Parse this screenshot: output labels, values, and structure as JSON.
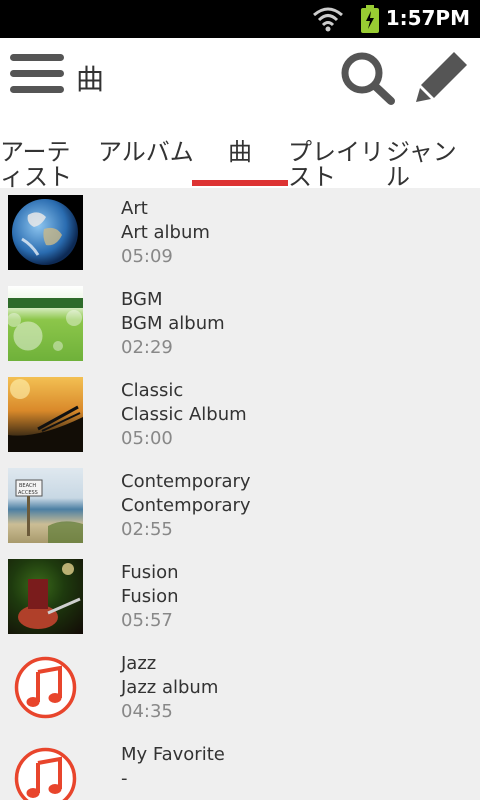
{
  "status_bar": {
    "time": "1:57PM",
    "icons": [
      "wifi-icon",
      "battery-charging-icon"
    ]
  },
  "action_bar": {
    "title": "曲",
    "icons": [
      "menu-icon",
      "search-icon",
      "edit-icon"
    ]
  },
  "tabs": [
    {
      "label": "アーティスト",
      "selected": false
    },
    {
      "label": "アルバム",
      "selected": false
    },
    {
      "label": "曲",
      "selected": true
    },
    {
      "label": "プレイリスト",
      "selected": false
    },
    {
      "label": "ジャンル",
      "selected": false
    }
  ],
  "colors": {
    "accent": "#d33333",
    "note_icon": "#e8452c"
  },
  "songs": [
    {
      "title": "Art",
      "album": "Art album",
      "duration": "05:09",
      "thumb": "earth-photo"
    },
    {
      "title": "BGM",
      "album": "BGM album",
      "duration": "02:29",
      "thumb": "bubbles-field-photo"
    },
    {
      "title": "Classic",
      "album": "Classic Album",
      "duration": "05:00",
      "thumb": "boat-sunset-photo"
    },
    {
      "title": "Contemporary",
      "album": "Contemporary",
      "duration": "02:55",
      "thumb": "beach-access-photo"
    },
    {
      "title": "Fusion",
      "album": "Fusion",
      "duration": "05:57",
      "thumb": "guitarist-photo"
    },
    {
      "title": "Jazz",
      "album": "Jazz album",
      "duration": "04:35",
      "thumb": "music-note-icon"
    },
    {
      "title": "My Favorite",
      "album": "-",
      "duration": "",
      "thumb": "music-note-icon"
    }
  ]
}
